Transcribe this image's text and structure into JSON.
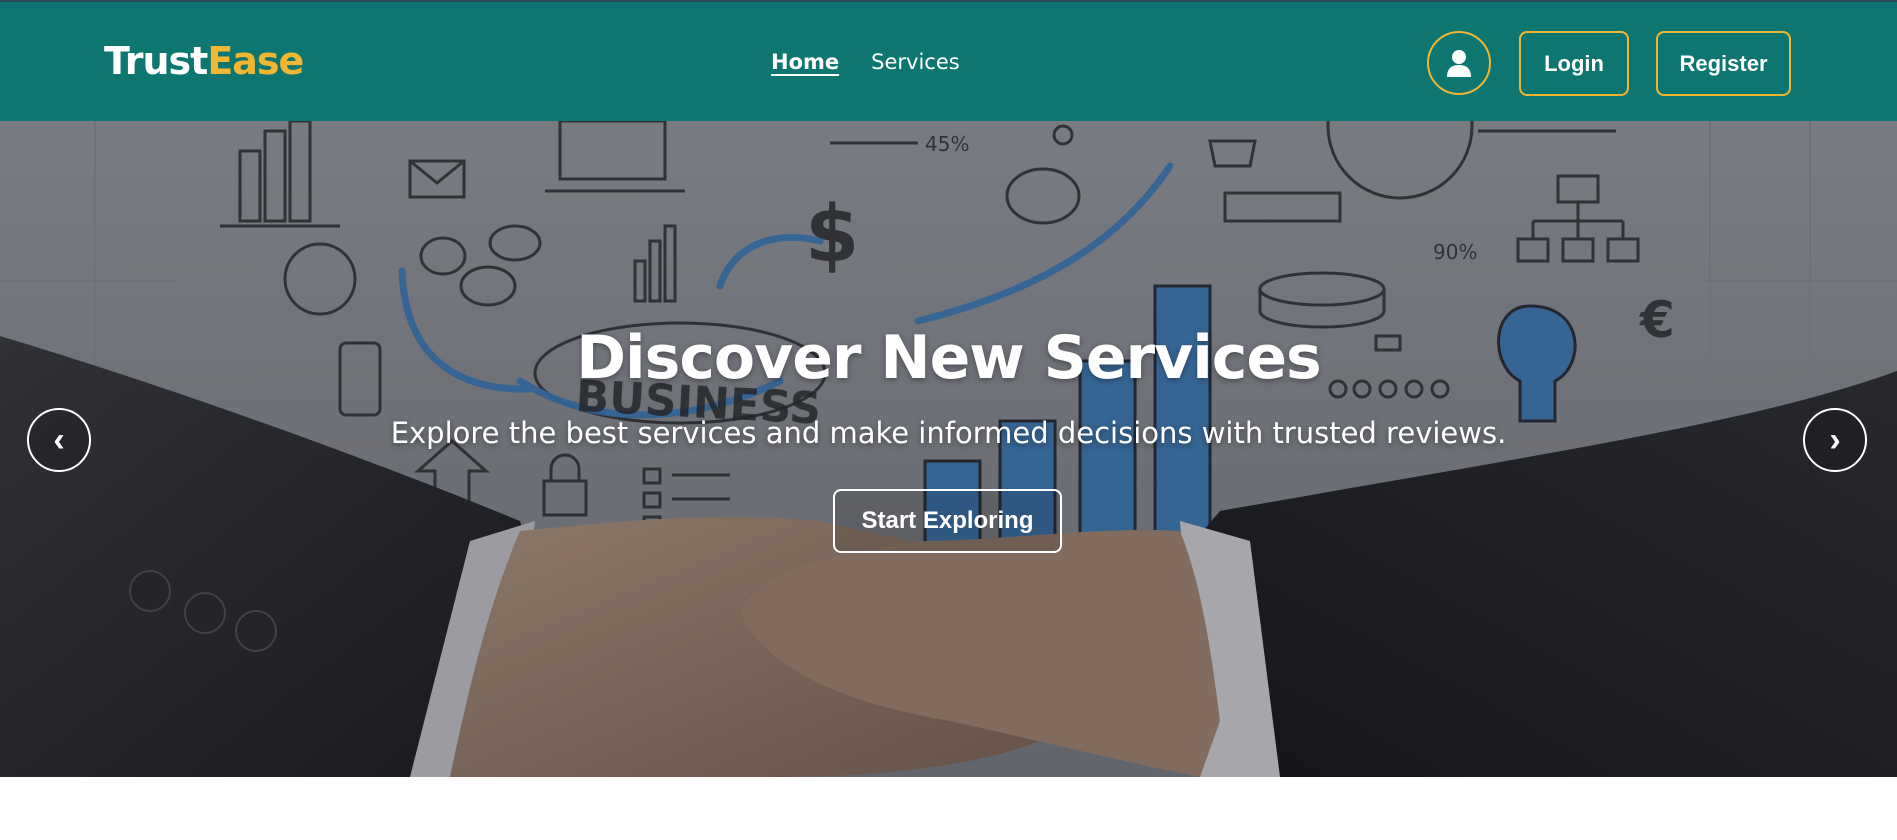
{
  "brand": {
    "part1": "Trust",
    "part2": "Ease"
  },
  "nav": {
    "items": [
      {
        "label": "Home",
        "active": true
      },
      {
        "label": "Services",
        "active": false
      }
    ]
  },
  "header": {
    "profile_icon": "user-icon",
    "login_label": "Login",
    "register_label": "Register"
  },
  "hero": {
    "title": "Discover New Services",
    "subtitle": "Explore the best services and make informed decisions with trusted reviews.",
    "cta_label": "Start Exploring",
    "prev_label": "‹",
    "next_label": "›",
    "background_illustration": {
      "labels": [
        "BUSINESS",
        "45%",
        "90%",
        "$",
        "€"
      ]
    }
  },
  "colors": {
    "nav_bg": "#0e7670",
    "accent": "#f2b632",
    "hero_text": "#ffffff"
  }
}
